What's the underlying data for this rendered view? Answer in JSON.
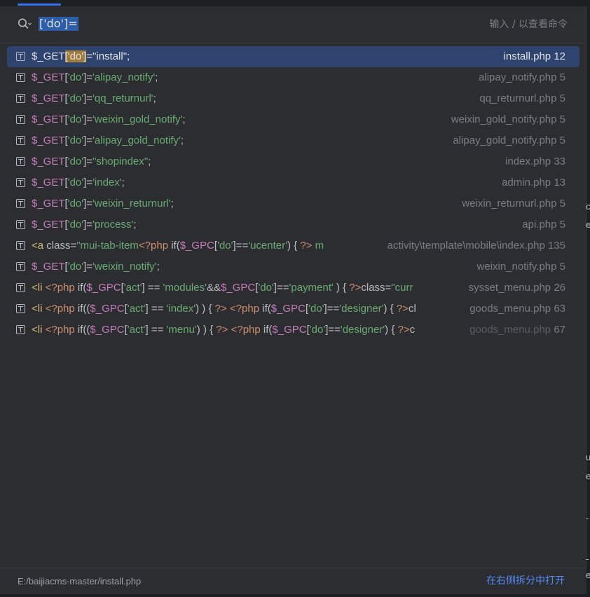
{
  "search": {
    "query": "['do']=",
    "hint": "输入 / 以查看命令"
  },
  "results": [
    {
      "tokens": [
        {
          "t": "$_GET",
          "c": "var"
        },
        {
          "t": "['do']",
          "c": "hl"
        },
        {
          "t": "=",
          "c": "pun"
        },
        {
          "t": "\"install\"",
          "c": "dstr"
        },
        {
          "t": ";",
          "c": "pun"
        }
      ],
      "file": "install.php",
      "line": "12",
      "selected": true
    },
    {
      "tokens": [
        {
          "t": "$_GET",
          "c": "var"
        },
        {
          "t": "[",
          "c": "pun"
        },
        {
          "t": "'do'",
          "c": "str"
        },
        {
          "t": "]=",
          "c": "pun"
        },
        {
          "t": "'alipay_notify'",
          "c": "str"
        },
        {
          "t": ";",
          "c": "pun"
        }
      ],
      "file": "alipay_notify.php",
      "line": "5"
    },
    {
      "tokens": [
        {
          "t": "$_GET",
          "c": "var"
        },
        {
          "t": "[",
          "c": "pun"
        },
        {
          "t": "'do'",
          "c": "str"
        },
        {
          "t": "]=",
          "c": "pun"
        },
        {
          "t": "'qq_returnurl'",
          "c": "str"
        },
        {
          "t": ";",
          "c": "pun"
        }
      ],
      "file": "qq_returnurl.php",
      "line": "5"
    },
    {
      "tokens": [
        {
          "t": "$_GET",
          "c": "var"
        },
        {
          "t": "[",
          "c": "pun"
        },
        {
          "t": "'do'",
          "c": "str"
        },
        {
          "t": "]=",
          "c": "pun"
        },
        {
          "t": "'weixin_gold_notify'",
          "c": "str"
        },
        {
          "t": ";",
          "c": "pun"
        }
      ],
      "file": "weixin_gold_notify.php",
      "line": "5"
    },
    {
      "tokens": [
        {
          "t": "$_GET",
          "c": "var"
        },
        {
          "t": "[",
          "c": "pun"
        },
        {
          "t": "'do'",
          "c": "str"
        },
        {
          "t": "]=",
          "c": "pun"
        },
        {
          "t": "'alipay_gold_notify'",
          "c": "str"
        },
        {
          "t": ";",
          "c": "pun"
        }
      ],
      "file": "alipay_gold_notify.php",
      "line": "5"
    },
    {
      "tokens": [
        {
          "t": "$_GET",
          "c": "var"
        },
        {
          "t": "[",
          "c": "pun"
        },
        {
          "t": "'do'",
          "c": "str"
        },
        {
          "t": "]=",
          "c": "pun"
        },
        {
          "t": "\"shopindex\"",
          "c": "dstr"
        },
        {
          "t": ";",
          "c": "pun"
        }
      ],
      "file": "index.php",
      "line": "33"
    },
    {
      "tokens": [
        {
          "t": "$_GET",
          "c": "var"
        },
        {
          "t": "[",
          "c": "pun"
        },
        {
          "t": "'do'",
          "c": "str"
        },
        {
          "t": "]=",
          "c": "pun"
        },
        {
          "t": "'index'",
          "c": "str"
        },
        {
          "t": ";",
          "c": "pun"
        }
      ],
      "file": "admin.php",
      "line": "13"
    },
    {
      "tokens": [
        {
          "t": "$_GET",
          "c": "var"
        },
        {
          "t": "[",
          "c": "pun"
        },
        {
          "t": "'do'",
          "c": "str"
        },
        {
          "t": "]=",
          "c": "pun"
        },
        {
          "t": "'weixin_returnurl'",
          "c": "str"
        },
        {
          "t": ";",
          "c": "pun"
        }
      ],
      "file": "weixin_returnurl.php",
      "line": "5"
    },
    {
      "tokens": [
        {
          "t": "$_GET",
          "c": "var"
        },
        {
          "t": "[",
          "c": "pun"
        },
        {
          "t": "'do'",
          "c": "str"
        },
        {
          "t": "]=",
          "c": "pun"
        },
        {
          "t": "'process'",
          "c": "str"
        },
        {
          "t": ";",
          "c": "pun"
        }
      ],
      "file": "api.php",
      "line": "5"
    },
    {
      "tokens": [
        {
          "t": "<a ",
          "c": "tag"
        },
        {
          "t": "class",
          "c": "attr"
        },
        {
          "t": "=",
          "c": "pun"
        },
        {
          "t": "\"mui-tab-item",
          "c": "str"
        },
        {
          "t": "<?php ",
          "c": "kw"
        },
        {
          "t": " if(",
          "c": "pun"
        },
        {
          "t": "$_GPC",
          "c": "var"
        },
        {
          "t": "[",
          "c": "pun"
        },
        {
          "t": "'do'",
          "c": "str"
        },
        {
          "t": "]==",
          "c": "pun"
        },
        {
          "t": "'ucenter'",
          "c": "str"
        },
        {
          "t": ") { ",
          "c": "pun"
        },
        {
          "t": "?>",
          "c": "kw"
        },
        {
          "t": " m",
          "c": "str"
        }
      ],
      "file": "activity\\template\\mobile\\index.php",
      "line": "135",
      "narrow": true
    },
    {
      "tokens": [
        {
          "t": "$_GET",
          "c": "var"
        },
        {
          "t": "[",
          "c": "pun"
        },
        {
          "t": "'do'",
          "c": "str"
        },
        {
          "t": "]=",
          "c": "pun"
        },
        {
          "t": "'weixin_notify'",
          "c": "str"
        },
        {
          "t": ";",
          "c": "pun"
        }
      ],
      "file": "weixin_notify.php",
      "line": "5"
    },
    {
      "tokens": [
        {
          "t": "<li ",
          "c": "tag"
        },
        {
          "t": "<?php ",
          "c": "kw"
        },
        {
          "t": " if(",
          "c": "pun"
        },
        {
          "t": "$_GPC",
          "c": "var"
        },
        {
          "t": "[",
          "c": "pun"
        },
        {
          "t": "'act'",
          "c": "str"
        },
        {
          "t": "] == ",
          "c": "pun"
        },
        {
          "t": "'modules'",
          "c": "str"
        },
        {
          "t": "&&",
          "c": "pun"
        },
        {
          "t": "$_GPC",
          "c": "var"
        },
        {
          "t": "[",
          "c": "pun"
        },
        {
          "t": "'do'",
          "c": "str"
        },
        {
          "t": "]==",
          "c": "pun"
        },
        {
          "t": "'payment'",
          "c": "str"
        },
        {
          "t": " ) { ",
          "c": "pun"
        },
        {
          "t": "?>",
          "c": "kw"
        },
        {
          "t": "class",
          "c": "attr"
        },
        {
          "t": "=",
          "c": "pun"
        },
        {
          "t": "\"curr",
          "c": "str"
        }
      ],
      "file": "sysset_menu.php",
      "line": "26",
      "full": true
    },
    {
      "tokens": [
        {
          "t": "<li ",
          "c": "tag"
        },
        {
          "t": "<?php ",
          "c": "kw"
        },
        {
          "t": " if((",
          "c": "pun"
        },
        {
          "t": "$_GPC",
          "c": "var"
        },
        {
          "t": "[",
          "c": "pun"
        },
        {
          "t": "'act'",
          "c": "str"
        },
        {
          "t": "] == ",
          "c": "pun"
        },
        {
          "t": "'index'",
          "c": "str"
        },
        {
          "t": ") ) { ",
          "c": "pun"
        },
        {
          "t": "?> ",
          "c": "kw"
        },
        {
          "t": " ",
          "c": "pun"
        },
        {
          "t": "<?php ",
          "c": "kw"
        },
        {
          "t": " if(",
          "c": "pun"
        },
        {
          "t": "$_GPC",
          "c": "var"
        },
        {
          "t": "[",
          "c": "pun"
        },
        {
          "t": "'do'",
          "c": "str"
        },
        {
          "t": "]==",
          "c": "pun"
        },
        {
          "t": "'designer'",
          "c": "str"
        },
        {
          "t": ") { ",
          "c": "pun"
        },
        {
          "t": "?>",
          "c": "kw"
        },
        {
          "t": "cl",
          "c": "attr"
        }
      ],
      "file": "goods_menu.php",
      "line": "63",
      "full": true
    },
    {
      "tokens": [
        {
          "t": "<li ",
          "c": "tag"
        },
        {
          "t": "<?php ",
          "c": "kw"
        },
        {
          "t": " if((",
          "c": "pun"
        },
        {
          "t": "$_GPC",
          "c": "var"
        },
        {
          "t": "[",
          "c": "pun"
        },
        {
          "t": "'act'",
          "c": "str"
        },
        {
          "t": "] == ",
          "c": "pun"
        },
        {
          "t": "'menu'",
          "c": "str"
        },
        {
          "t": ") ) { ",
          "c": "pun"
        },
        {
          "t": "?> ",
          "c": "kw"
        },
        {
          "t": " ",
          "c": "pun"
        },
        {
          "t": "<?php ",
          "c": "kw"
        },
        {
          "t": " if(",
          "c": "pun"
        },
        {
          "t": "$_GPC",
          "c": "var"
        },
        {
          "t": "[",
          "c": "pun"
        },
        {
          "t": "'do'",
          "c": "str"
        },
        {
          "t": "]==",
          "c": "pun"
        },
        {
          "t": "'designer'",
          "c": "str"
        },
        {
          "t": ") { ",
          "c": "pun"
        },
        {
          "t": "?>",
          "c": "kw"
        },
        {
          "t": "c",
          "c": "attr"
        }
      ],
      "file": "goods_menu.php",
      "line": "67",
      "full": true,
      "dimfile": true
    }
  ],
  "footer": {
    "path": "E:/baijiacms-master/install.php",
    "action": "在右侧拆分中打开"
  },
  "colors": {
    "selection": "#2e436e",
    "accent": "#3574f0",
    "link": "#548af7"
  }
}
